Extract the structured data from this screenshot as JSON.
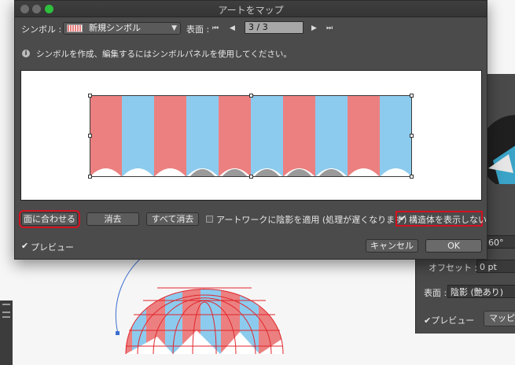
{
  "window": {
    "title": "アートをマップ"
  },
  "symbol": {
    "label": "シンボル :",
    "selected": "新規シンボル"
  },
  "surface": {
    "label": "表面 :",
    "value": "3 / 3"
  },
  "info_text": "シンボルを作成、編集するにはシンボルパネルを使用してください。",
  "art": {
    "stripe_colors": [
      "#ec8080",
      "#8ccbee"
    ],
    "stripe_count": 10
  },
  "buttons": {
    "fit_to_surface": "面に合わせる",
    "clear": "消去",
    "clear_all": "すべて消去",
    "cancel": "キャンセル",
    "ok": "OK"
  },
  "options": {
    "shade_artwork": "アートワークに陰影を適用 (処理が遅くなります)",
    "shade_artwork_checked": false,
    "hide_geometry": "構造体を表示しない",
    "hide_geometry_checked": true,
    "preview": "プレビュー",
    "preview_checked": true
  },
  "background_panel": {
    "angle_value": "60°",
    "offset_label": "オフセット :",
    "offset_value": "0 pt",
    "surface_label": "表面 :",
    "surface_value": "陰影 (艶あり)",
    "preview_label": "プレビュー",
    "map_button": "マッピ"
  },
  "colors": {
    "highlight": "#d4111f",
    "dialog_bg": "#4b4b4b"
  }
}
